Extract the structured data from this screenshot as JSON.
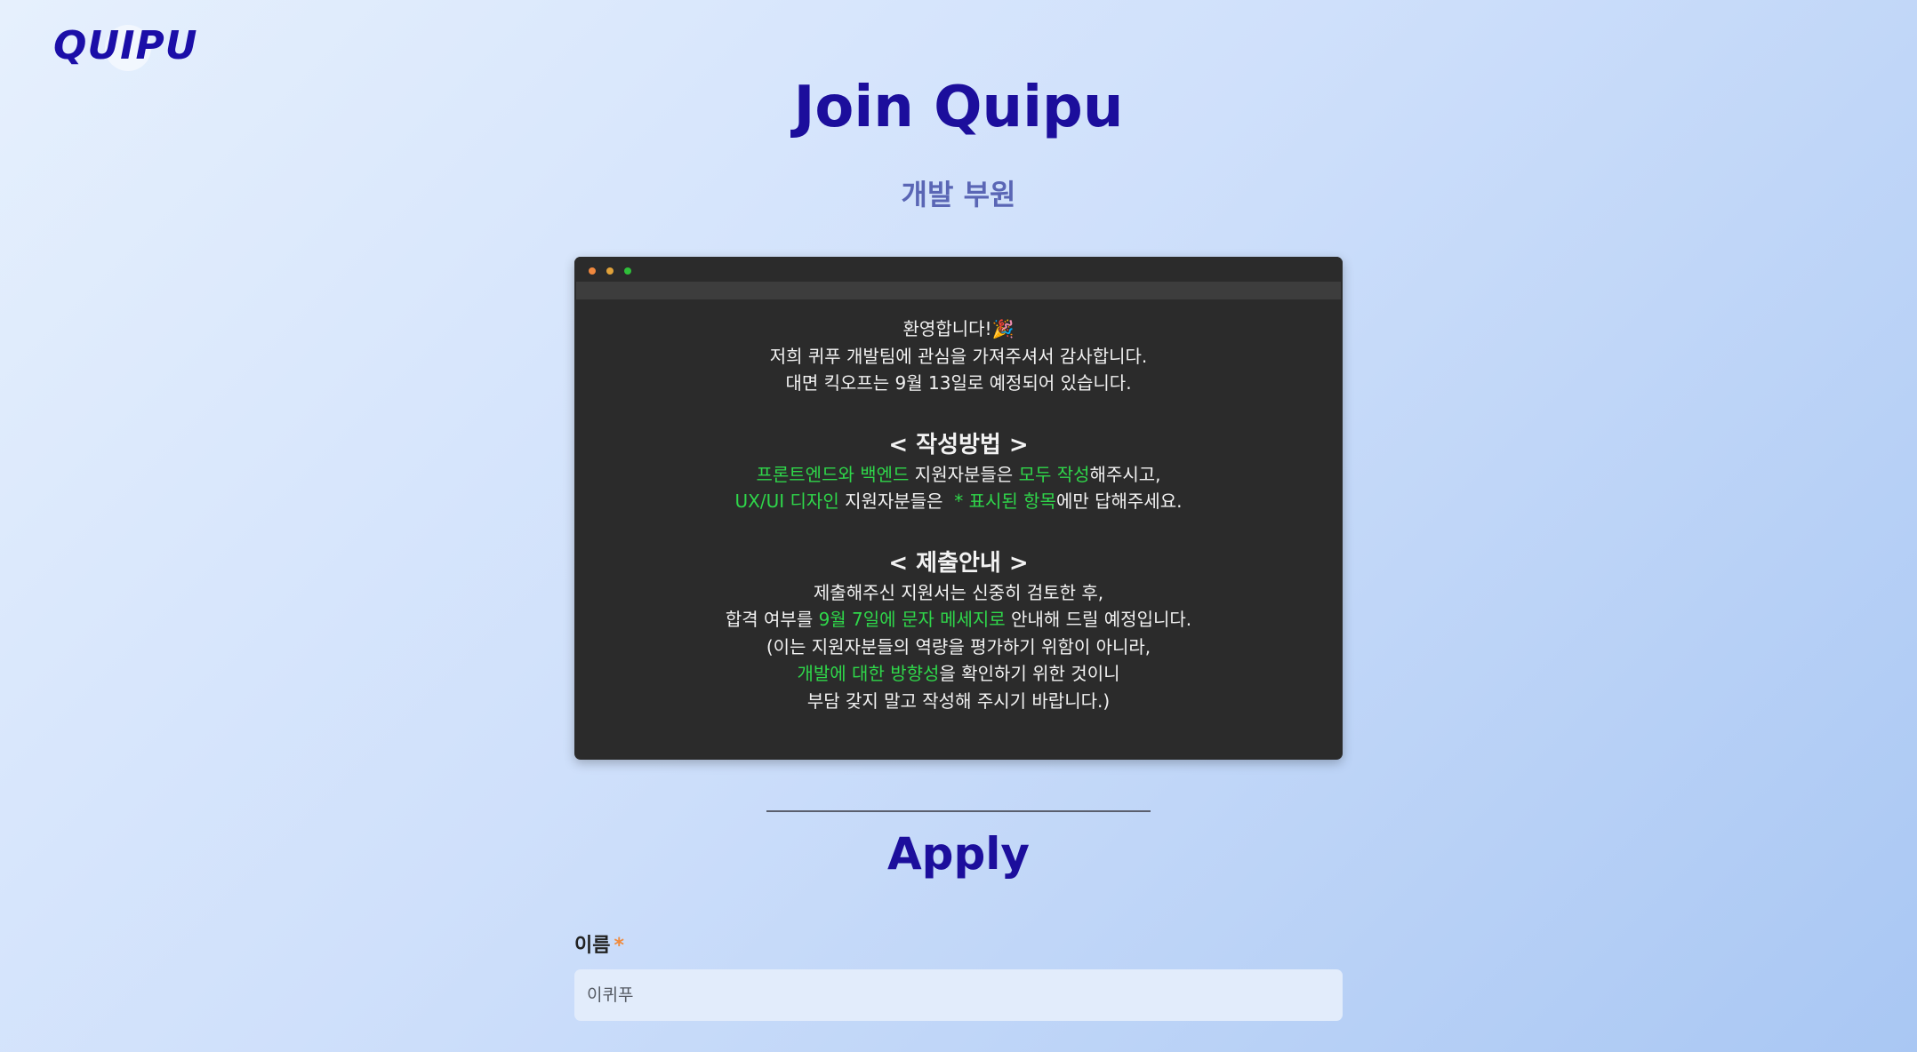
{
  "logo": {
    "text": "QUIPU"
  },
  "header": {
    "title": "Join Quipu",
    "subtitle": "개발 부원"
  },
  "intro": {
    "window_dots": [
      "#f0883e",
      "#e0a13a",
      "#2fbf3a"
    ],
    "welcome": "환영합니다!🎉",
    "line2": "저희 퀴푸 개발팀에 관심을 가져주셔서 감사합니다.",
    "line3": "대면 킥오프는 9월 13일로 예정되어 있습니다.",
    "how_heading": "< 작성방법 >",
    "how": {
      "frontend_backend": "프론트엔드와 백엔드",
      "applicants_1": " 지원자분들은 ",
      "write_all": "모두 작성",
      "suffix_1": "해주시고,",
      "uxui": "UX/UI 디자인",
      "applicants_2": " 지원자분들은  ",
      "marked_items": "* 표시된 항목",
      "suffix_2": "에만 답해주세요."
    },
    "submit_heading": "< 제출안내 >",
    "submit": {
      "line1": "제출해주신 지원서는 신중히 검토한 후,",
      "line2_prefix": "합격 여부를 ",
      "line2_highlight": "9월 7일에 문자 메세지로",
      "line2_suffix": " 안내해 드릴 예정입니다.",
      "line3": "(이는 지원자분들의 역량을 평가하기 위함이 아니라,",
      "line4_highlight": "개발에 대한 방향성",
      "line4_suffix": "을 확인하기 위한 것이니",
      "line5": "부담 갖지 말고 작성해 주시기 바랍니다.)"
    },
    "highlight_color": "#2fd64a"
  },
  "apply": {
    "title": "Apply",
    "name_field": {
      "label": "이름",
      "required_mark": "*",
      "placeholder": "이퀴푸"
    }
  }
}
